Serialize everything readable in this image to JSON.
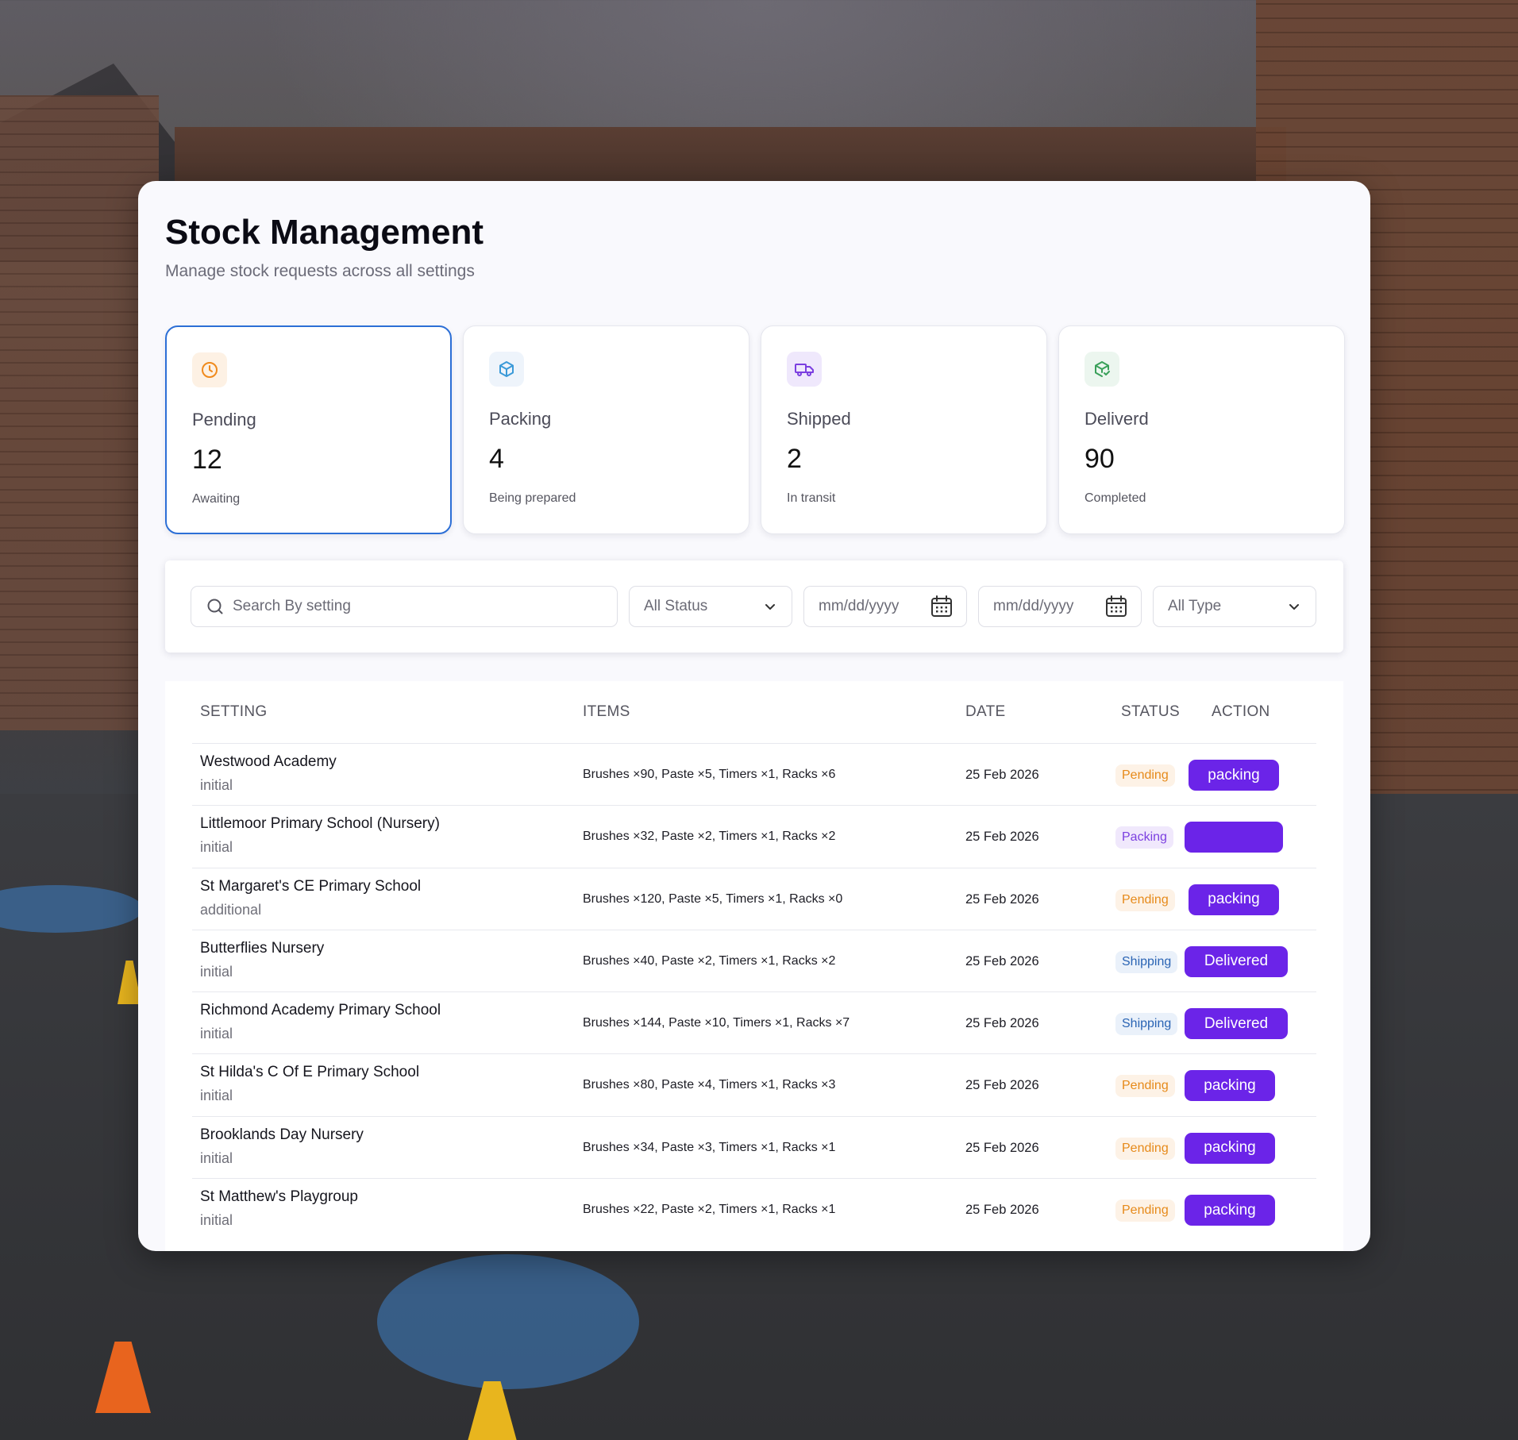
{
  "header": {
    "title": "Stock Management",
    "subtitle": "Manage stock requests across all settings"
  },
  "cards": [
    {
      "label": "Pending",
      "value": "12",
      "note": "Awaiting",
      "icon": "clock-icon",
      "color": "#f08a1c",
      "bg": "#fdf1e4"
    },
    {
      "label": "Packing",
      "value": "4",
      "note": "Being prepared",
      "icon": "box-icon",
      "color": "#3b9ad8",
      "bg": "#eef4fb"
    },
    {
      "label": "Shipped",
      "value": "2",
      "note": "In transit",
      "icon": "truck-icon",
      "color": "#7b3fe0",
      "bg": "#efe8fc"
    },
    {
      "label": "Deliverd",
      "value": "90",
      "note": "Completed",
      "icon": "package-check-icon",
      "color": "#3aa05a",
      "bg": "#ecf6ef"
    }
  ],
  "filters": {
    "search_placeholder": "Search By setting",
    "status_selected": "All Status",
    "date_from_placeholder": "mm/dd/yyyy",
    "date_to_placeholder": "mm/dd/yyyy",
    "type_selected": "All Type"
  },
  "table": {
    "columns": [
      "SETTING",
      "ITEMS",
      "DATE",
      "STATUS",
      "ACTION"
    ],
    "rows": [
      {
        "setting": "Westwood Academy",
        "type": "initial",
        "items": "Brushes ×90, Paste ×5, Timers ×1, Racks ×6",
        "date": "25 Feb 2026",
        "status": "Pending",
        "action": "packing"
      },
      {
        "setting": "Littlemoor Primary School (Nursery)",
        "type": "initial",
        "items": "Brushes ×32, Paste ×2, Timers ×1, Racks ×2",
        "date": "25 Feb 2026",
        "status": "Packing",
        "action": ""
      },
      {
        "setting": "St Margaret's CE Primary School",
        "type": "additional",
        "items": "Brushes ×120, Paste ×5, Timers ×1, Racks ×0",
        "date": "25 Feb 2026",
        "status": "Pending",
        "action": "packing"
      },
      {
        "setting": "Butterflies Nursery",
        "type": "initial",
        "items": "Brushes ×40, Paste ×2, Timers ×1, Racks ×2",
        "date": "25 Feb 2026",
        "status": "Shipping",
        "action": "Delivered"
      },
      {
        "setting": "Richmond Academy Primary School",
        "type": "initial",
        "items": "Brushes ×144, Paste ×10, Timers ×1, Racks ×7",
        "date": "25 Feb 2026",
        "status": "Shipping",
        "action": "Delivered"
      },
      {
        "setting": "St Hilda's C Of E Primary School",
        "type": "initial",
        "items": "Brushes ×80, Paste ×4, Timers ×1, Racks ×3",
        "date": "25 Feb 2026",
        "status": "Pending",
        "action": "packing"
      },
      {
        "setting": "Brooklands Day Nursery",
        "type": "initial",
        "items": "Brushes ×34, Paste ×3, Timers ×1, Racks ×1",
        "date": "25 Feb 2026",
        "status": "Pending",
        "action": "packing"
      },
      {
        "setting": "St Matthew's Playgroup",
        "type": "initial",
        "items": "Brushes ×22, Paste ×2, Timers ×1, Racks ×1",
        "date": "25 Feb 2026",
        "status": "Pending",
        "action": "packing"
      }
    ]
  },
  "colors": {
    "accent": "#6b24e8",
    "active_card_border": "#2c6fd6"
  }
}
